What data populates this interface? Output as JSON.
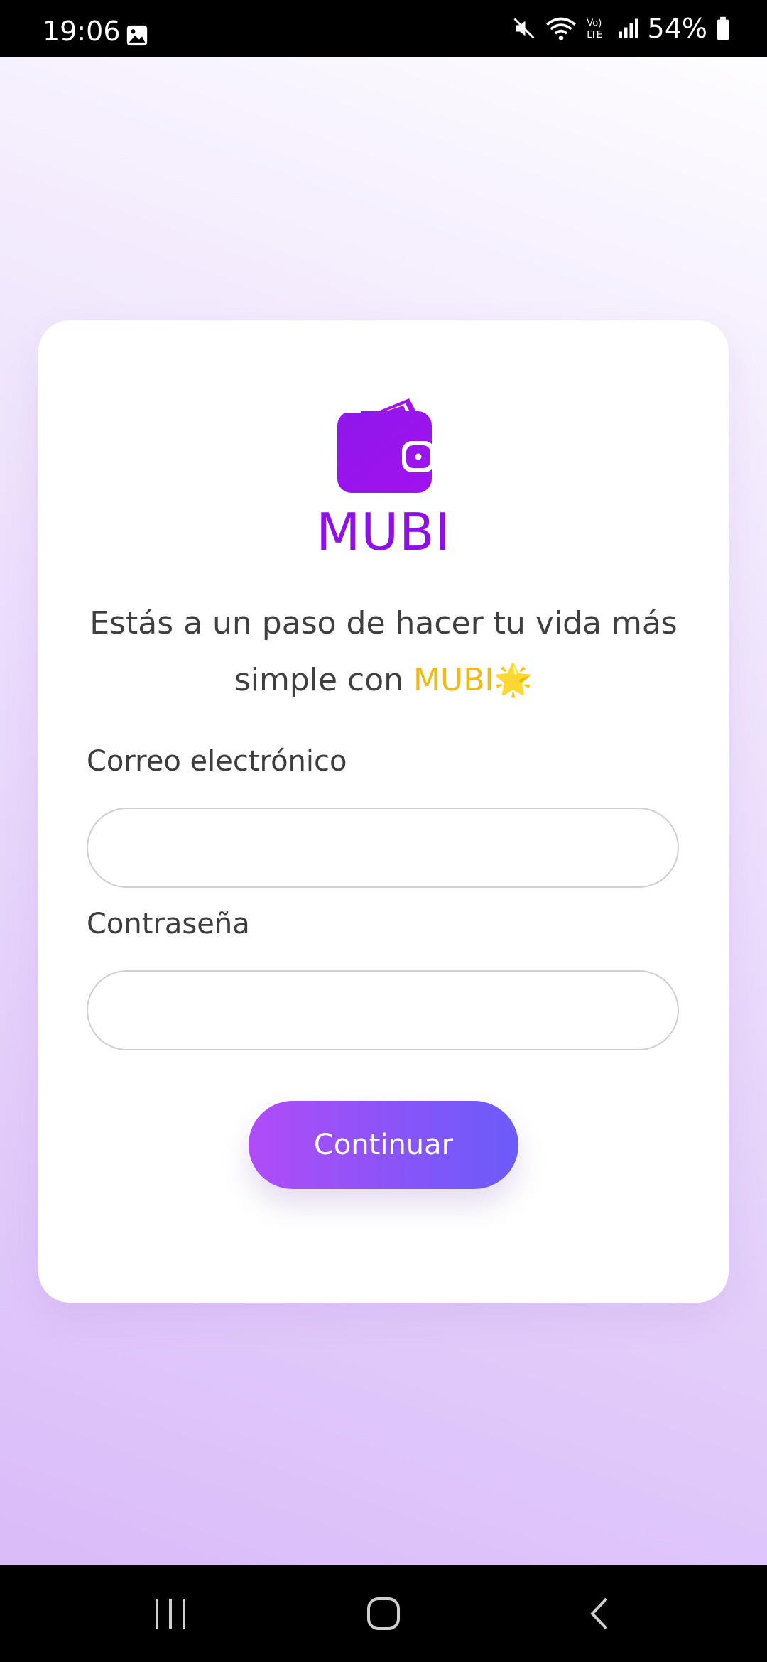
{
  "status_bar": {
    "time": "19:06",
    "battery": "54%",
    "icons": [
      "gallery-icon",
      "mute-icon",
      "wifi-icon",
      "volte-icon",
      "signal-icon",
      "battery-icon"
    ]
  },
  "brand": {
    "name": "MUBI",
    "logo_icon": "wallet-icon",
    "color": "#8e0fe8"
  },
  "tagline": {
    "prefix": "Estás a un paso de hacer tu vida más simple con ",
    "accent": "MUBI",
    "emoji": "🌟",
    "accent_color": "#f0b913"
  },
  "form": {
    "email_label": "Correo electrónico",
    "email_value": "",
    "password_label": "Contraseña",
    "password_value": "",
    "submit_label": "Continuar"
  },
  "nav_bar": {
    "icons": [
      "recents-icon",
      "home-icon",
      "back-icon"
    ]
  }
}
